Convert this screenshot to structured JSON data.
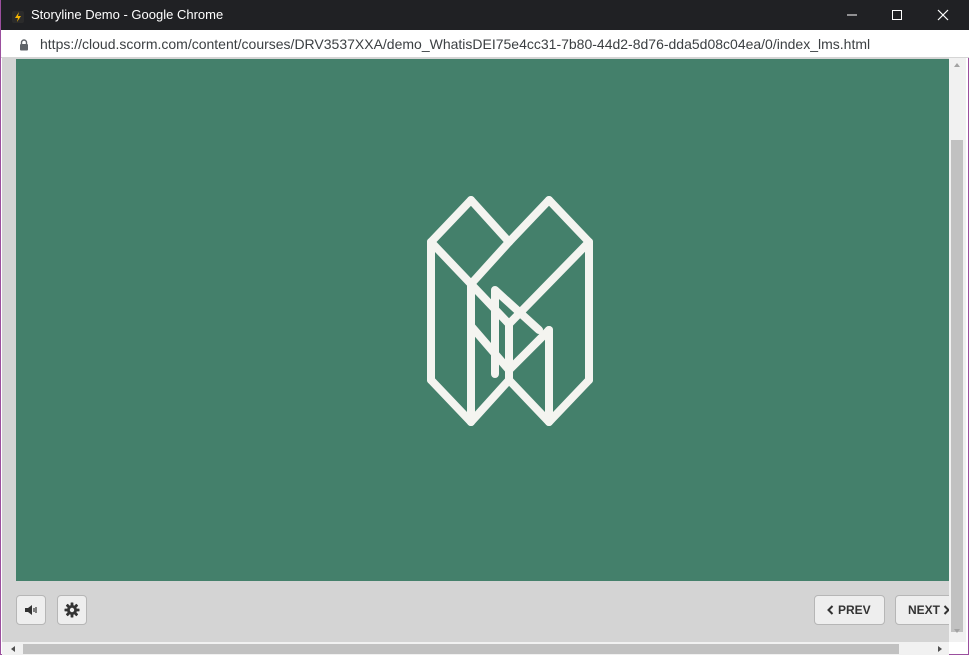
{
  "window": {
    "title": "Storyline Demo - Google Chrome",
    "url": "https://cloud.scorm.com/content/courses/DRV3537XXA/demo_WhatisDEI75e4cc31-7b80-44d2-8d76-dda5d08c04ea/0/index_lms.html"
  },
  "titlebar_icons": {
    "favicon": "storyline-favicon-icon",
    "minimize": "minimize-icon",
    "maximize": "maximize-icon",
    "close": "close-icon"
  },
  "slide": {
    "background": "#44806b",
    "logo": "geometric-m-logo"
  },
  "player": {
    "volume_icon": "volume-icon",
    "settings_icon": "gear-icon",
    "prev_label": "PREV",
    "next_label": "NEXT"
  },
  "colors": {
    "titlebar": "#202124",
    "slide_green": "#44806b",
    "control_bar": "#d4d4d4",
    "window_border": "#9b4f9e"
  }
}
